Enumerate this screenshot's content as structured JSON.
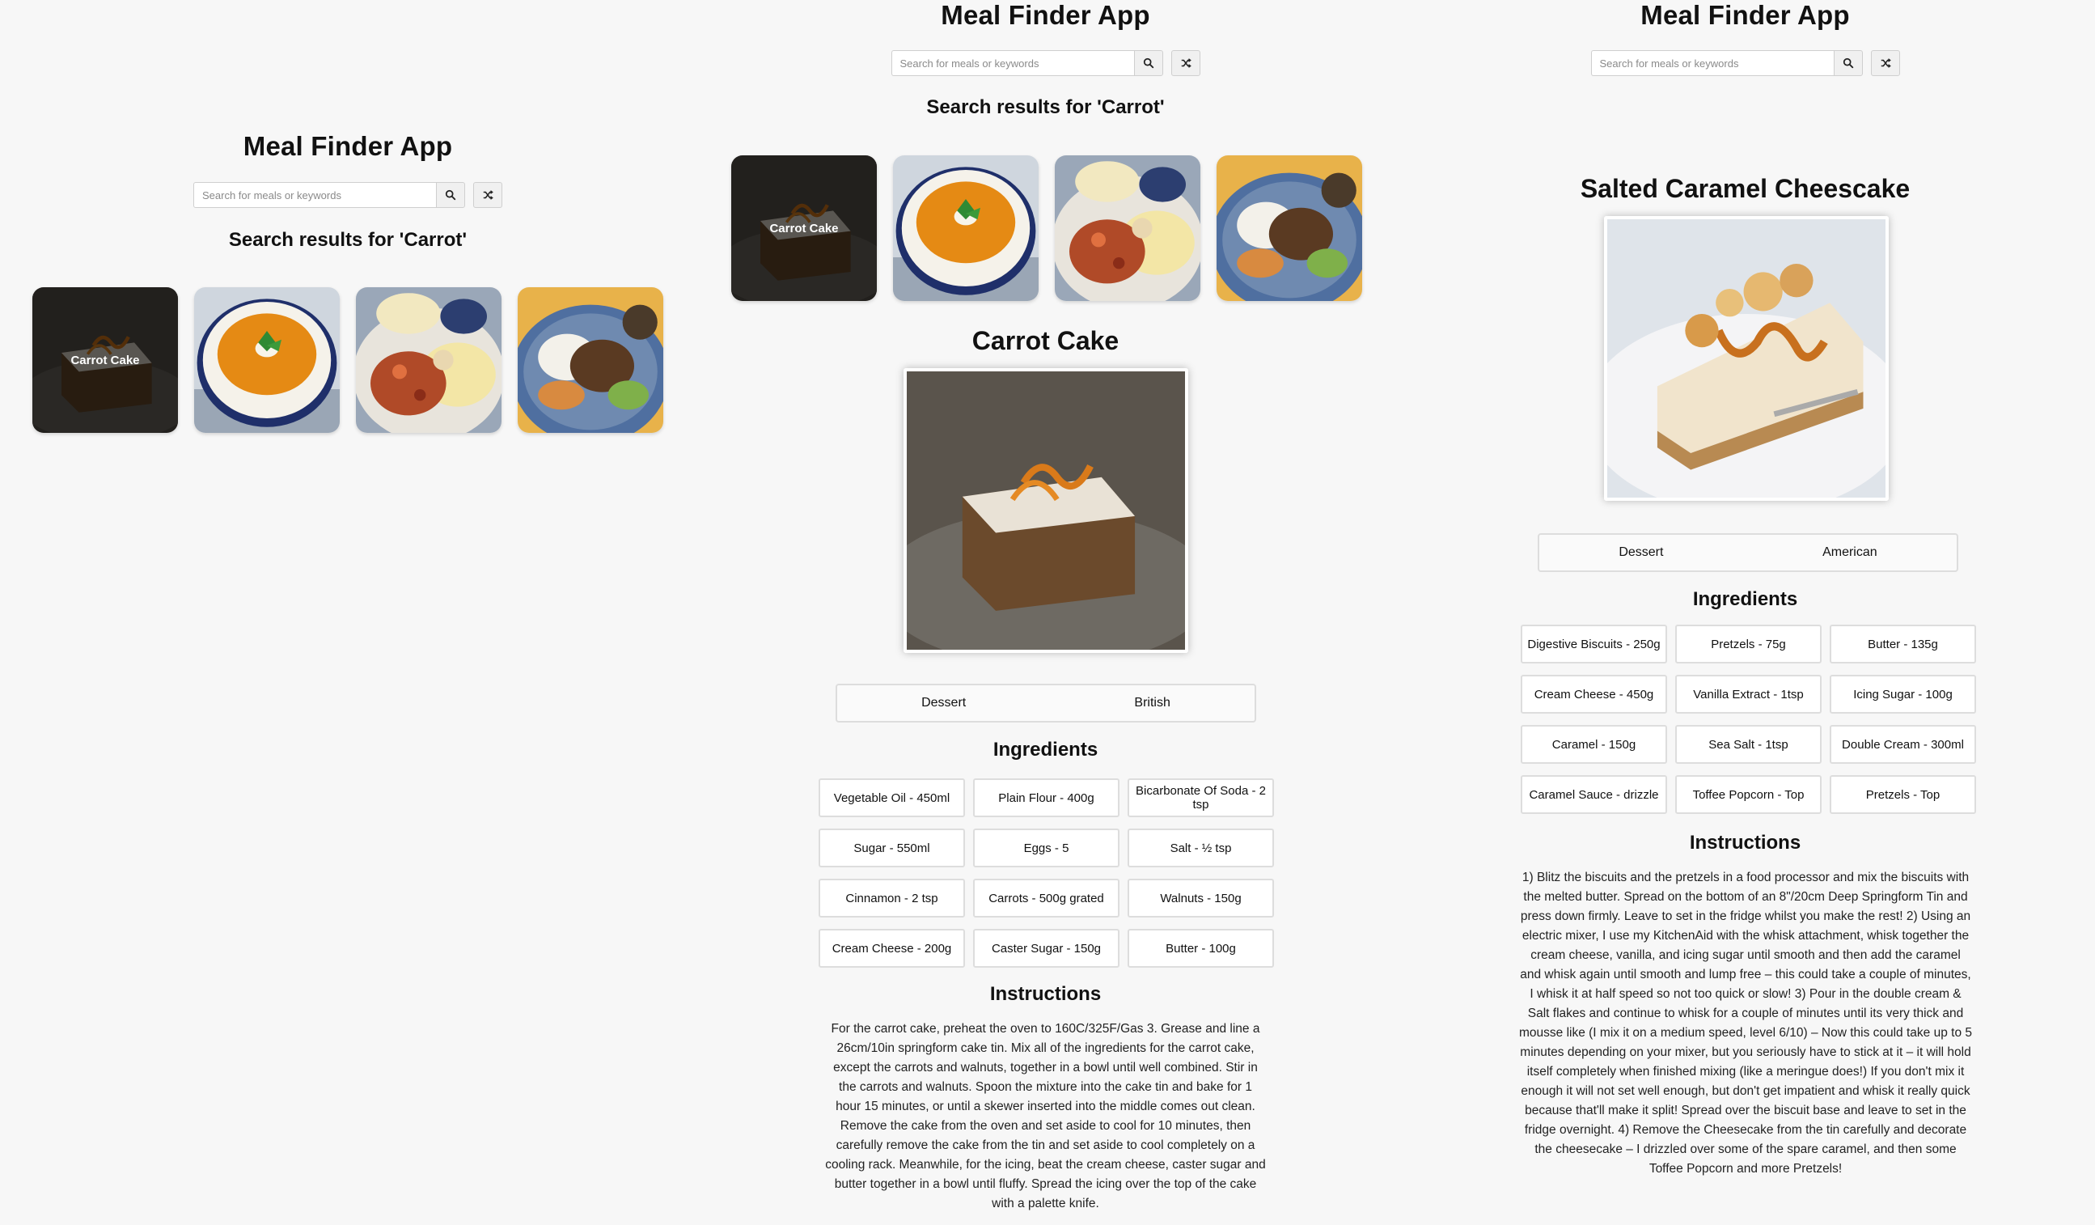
{
  "app_title": "Meal Finder App",
  "search": {
    "placeholder": "Search for meals or keywords",
    "search_icon": "search-icon",
    "random_icon": "shuffle-icon"
  },
  "results_heading": "Search results for 'Carrot'",
  "search_results": [
    {
      "name": "Carrot Cake",
      "overlay_text": "Carrot Cake",
      "image": "carrot-cake-photo"
    },
    {
      "image": "carrot-soup-photo"
    },
    {
      "image": "pasta-bake-photo"
    },
    {
      "image": "rice-bowl-photo"
    }
  ],
  "carrot_cake": {
    "title": "Carrot Cake",
    "image": "carrot-cake-photo",
    "category": "Dessert",
    "area": "British",
    "ingredients_heading": "Ingredients",
    "ingredients": [
      "Vegetable Oil - 450ml",
      "Plain Flour - 400g",
      "Bicarbonate Of Soda - 2 tsp",
      "Sugar - 550ml",
      "Eggs - 5",
      "Salt - ½ tsp",
      "Cinnamon - 2 tsp",
      "Carrots - 500g grated",
      "Walnuts - 150g",
      "Cream Cheese - 200g",
      "Caster Sugar - 150g",
      "Butter - 100g"
    ],
    "instructions_heading": "Instructions",
    "instructions": "For the carrot cake, preheat the oven to 160C/325F/Gas 3. Grease and line a 26cm/10in springform cake tin. Mix all of the ingredients for the carrot cake, except the carrots and walnuts, together in a bowl until well combined. Stir in the carrots and walnuts. Spoon the mixture into the cake tin and bake for 1 hour 15 minutes, or until a skewer inserted into the middle comes out clean. Remove the cake from the oven and set aside to cool for 10 minutes, then carefully remove the cake from the tin and set aside to cool completely on a cooling rack. Meanwhile, for the icing, beat the cream cheese, caster sugar and butter together in a bowl until fluffy. Spread the icing over the top of the cake with a palette knife."
  },
  "cheesecake": {
    "title": "Salted Caramel Cheescake",
    "image": "salted-caramel-cheesecake-photo",
    "category": "Dessert",
    "area": "American",
    "ingredients_heading": "Ingredients",
    "ingredients": [
      "Digestive Biscuits - 250g",
      "Pretzels - 75g",
      "Butter - 135g",
      "Cream Cheese - 450g",
      "Vanilla Extract - 1tsp",
      "Icing Sugar - 100g",
      "Caramel - 150g",
      "Sea Salt - 1tsp",
      "Double Cream - 300ml",
      "Caramel Sauce - drizzle",
      "Toffee Popcorn - Top",
      "Pretzels - Top"
    ],
    "instructions_heading": "Instructions",
    "instructions": "1) Blitz the biscuits and the pretzels in a food processor and mix the biscuits with the melted butter. Spread on the bottom of an 8\"/20cm Deep Springform Tin and press down firmly. Leave to set in the fridge whilst you make the rest! 2) Using an electric mixer, I use my KitchenAid with the whisk attachment, whisk together the cream cheese, vanilla, and icing sugar until smooth and then add the caramel and whisk again until smooth and lump free – this could take a couple of minutes, I whisk it at half speed so not too quick or slow! 3) Pour in the double cream & Salt flakes and continue to whisk for a couple of minutes until its very thick and mousse like (I mix it on a medium speed, level 6/10) – Now this could take up to 5 minutes depending on your mixer, but you seriously have to stick at it – it will hold itself completely when finished mixing (like a meringue does!) If you don't mix it enough it will not set well enough, but don't get impatient and whisk it really quick because that'll make it split! Spread over the biscuit base and leave to set in the fridge overnight. 4) Remove the Cheesecake from the tin carefully and decorate the cheesecake – I drizzled over some of the spare caramel, and then some Toffee Popcorn and more Pretzels!"
  }
}
